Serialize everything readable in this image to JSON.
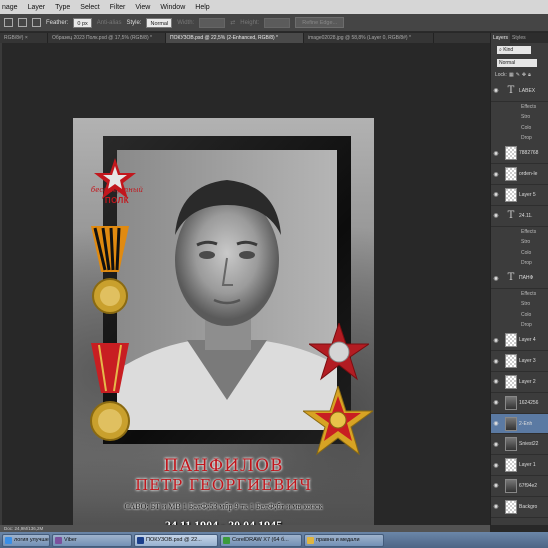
{
  "menu": [
    "nage",
    "Layer",
    "Type",
    "Select",
    "Filter",
    "View",
    "Window",
    "Help"
  ],
  "options": {
    "feather_label": "Feather:",
    "feather_value": "0 px",
    "antialias_label": "Anti-alias",
    "style_label": "Style:",
    "style_value": "Normal",
    "width_label": "Width:",
    "height_label": "Height:",
    "refine_button": "Refine Edge..."
  },
  "tabs": [
    {
      "label": "RGB/8#) ×",
      "active": false
    },
    {
      "label": "Образец 2023 Полк.psd @ 17,5% (RGB/8) *",
      "active": false
    },
    {
      "label": "ПОКУЗОВ.psd @ 22,5% (2-Enhanced, RGB/8) *",
      "active": true
    },
    {
      "label": "image02028.jpg @ 58,8% (Layer 0, RGB/8#) *",
      "active": false
    }
  ],
  "poster": {
    "logo_line1": "бессмертный",
    "logo_line2": "ПОЛК",
    "surname": "ПАНФИЛОВ",
    "given_names": "ПЕТР  ГЕОРГИЕВИЧ",
    "unit": "САВО; БТ и МВ 1 БелФ;53 мбр 9 тк 1 БелФ;бт и мв конск",
    "dates": "24.11.1904 - 20.04.1945"
  },
  "panel": {
    "tabs": [
      "Layers",
      "Styles"
    ],
    "filter_value": "Kind",
    "blend_value": "Normal",
    "lock_label": "Lock:",
    "layers": [
      {
        "name": "LABEX",
        "type": "text",
        "fx": false
      },
      {
        "name": "Effects",
        "type": "fx"
      },
      {
        "name": "Stro",
        "type": "fx"
      },
      {
        "name": "Colo",
        "type": "fx"
      },
      {
        "name": "Drop",
        "type": "fx"
      },
      {
        "name": "7882768",
        "type": "pixel",
        "fx": false
      },
      {
        "name": "orden-le",
        "type": "pixel",
        "fx": false
      },
      {
        "name": "Layer 5",
        "type": "pixel",
        "fx": false
      },
      {
        "name": "24.11.",
        "type": "text",
        "fx": false
      },
      {
        "name": "Effects",
        "type": "fx"
      },
      {
        "name": "Stro",
        "type": "fx"
      },
      {
        "name": "Colo",
        "type": "fx"
      },
      {
        "name": "Drop",
        "type": "fx"
      },
      {
        "name": "ПАНФ",
        "type": "text",
        "fx": false
      },
      {
        "name": "Effects",
        "type": "fx"
      },
      {
        "name": "Stro",
        "type": "fx"
      },
      {
        "name": "Colo",
        "type": "fx"
      },
      {
        "name": "Drop",
        "type": "fx"
      },
      {
        "name": "Layer 4",
        "type": "pixel",
        "fx": false
      },
      {
        "name": "Layer 3",
        "type": "pixel",
        "fx": false
      },
      {
        "name": "Layer 2",
        "type": "pixel",
        "fx": false
      },
      {
        "name": "1624256",
        "type": "image",
        "fx": false
      },
      {
        "name": "2-Enh",
        "type": "image",
        "selected": true
      },
      {
        "name": "Sniest22",
        "type": "image",
        "fx": false
      },
      {
        "name": "Layer 1",
        "type": "pixel",
        "fx": false
      },
      {
        "name": "67f94e2",
        "type": "image",
        "fx": false
      },
      {
        "name": "Backgro",
        "type": "pixel",
        "fx": false
      }
    ]
  },
  "status": "Doc: 24,9M/136,2M",
  "taskbar": [
    {
      "label": "логия улучше...",
      "color": "#3a8ee6"
    },
    {
      "label": "Viber",
      "color": "#7b519d"
    },
    {
      "label": "ПОКУЗОВ.psd @ 22...",
      "color": "#1b3f8c",
      "active": true
    },
    {
      "label": "CorelDRAW X7 (64 б...",
      "color": "#3c9b3c"
    },
    {
      "label": "правна и медали",
      "color": "#e0b540"
    }
  ]
}
